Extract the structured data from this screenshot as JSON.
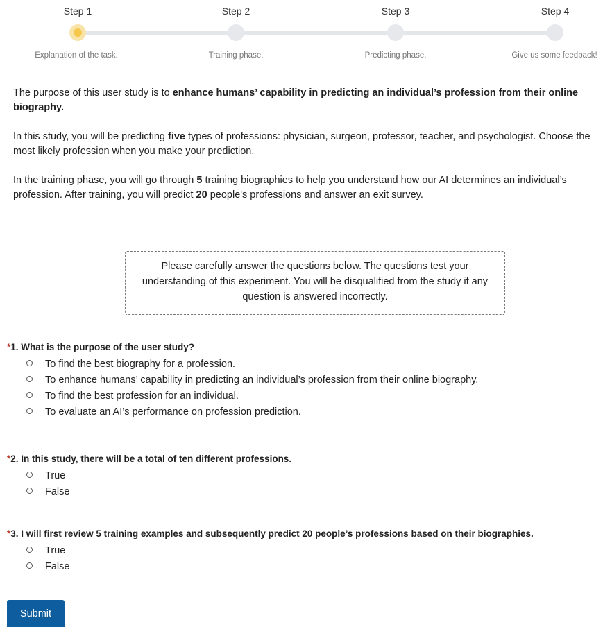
{
  "steps": [
    {
      "title": "Step 1",
      "subtitle": "Explanation of the task."
    },
    {
      "title": "Step 2",
      "subtitle": "Training phase."
    },
    {
      "title": "Step 3",
      "subtitle": "Predicting phase."
    },
    {
      "title": "Step 4",
      "subtitle": "Give us some feedback!"
    }
  ],
  "colors": {
    "active_step": "#f5c84b",
    "submit": "#0e5d9f",
    "required": "#c0392b"
  },
  "intro": {
    "p1_a": "The purpose of this user study is to ",
    "p1_b": "enhance humans’ capability in predicting an individual’s profession from their online biography.",
    "p2_a": "In this study, you will be predicting ",
    "p2_b": "five",
    "p2_c": " types of professions: physician, surgeon, professor, teacher, and psychologist. Choose the most likely profession when you make your prediction.",
    "p3_a": "In the training phase, you will go through ",
    "p3_b": "5",
    "p3_c": " training biographies to help you understand how our AI determines an individual’s profession. After training, you will predict ",
    "p3_d": "20",
    "p3_e": " people's professions and answer an exit survey."
  },
  "notice": "Please carefully answer the questions below. The questions test your understanding of this experiment. You will be disqualified from the study if any question is answered incorrectly.",
  "questions": [
    {
      "required_mark": "*",
      "title": "1. What is the purpose of the user study?",
      "options": [
        "To find the best biography for a profession.",
        "To enhance humans’ capability in predicting an individual’s profession from their online biography.",
        "To find the best profession for an individual.",
        "To evaluate an AI’s performance on profession prediction."
      ]
    },
    {
      "required_mark": "*",
      "title": "2. In this study, there will be a total of ten different professions.",
      "options": [
        "True",
        "False"
      ]
    },
    {
      "required_mark": "*",
      "title": "3. I will first review 5 training examples and subsequently predict 20 people’s professions based on their biographies.",
      "options": [
        "True",
        "False"
      ]
    }
  ],
  "submit_label": "Submit"
}
